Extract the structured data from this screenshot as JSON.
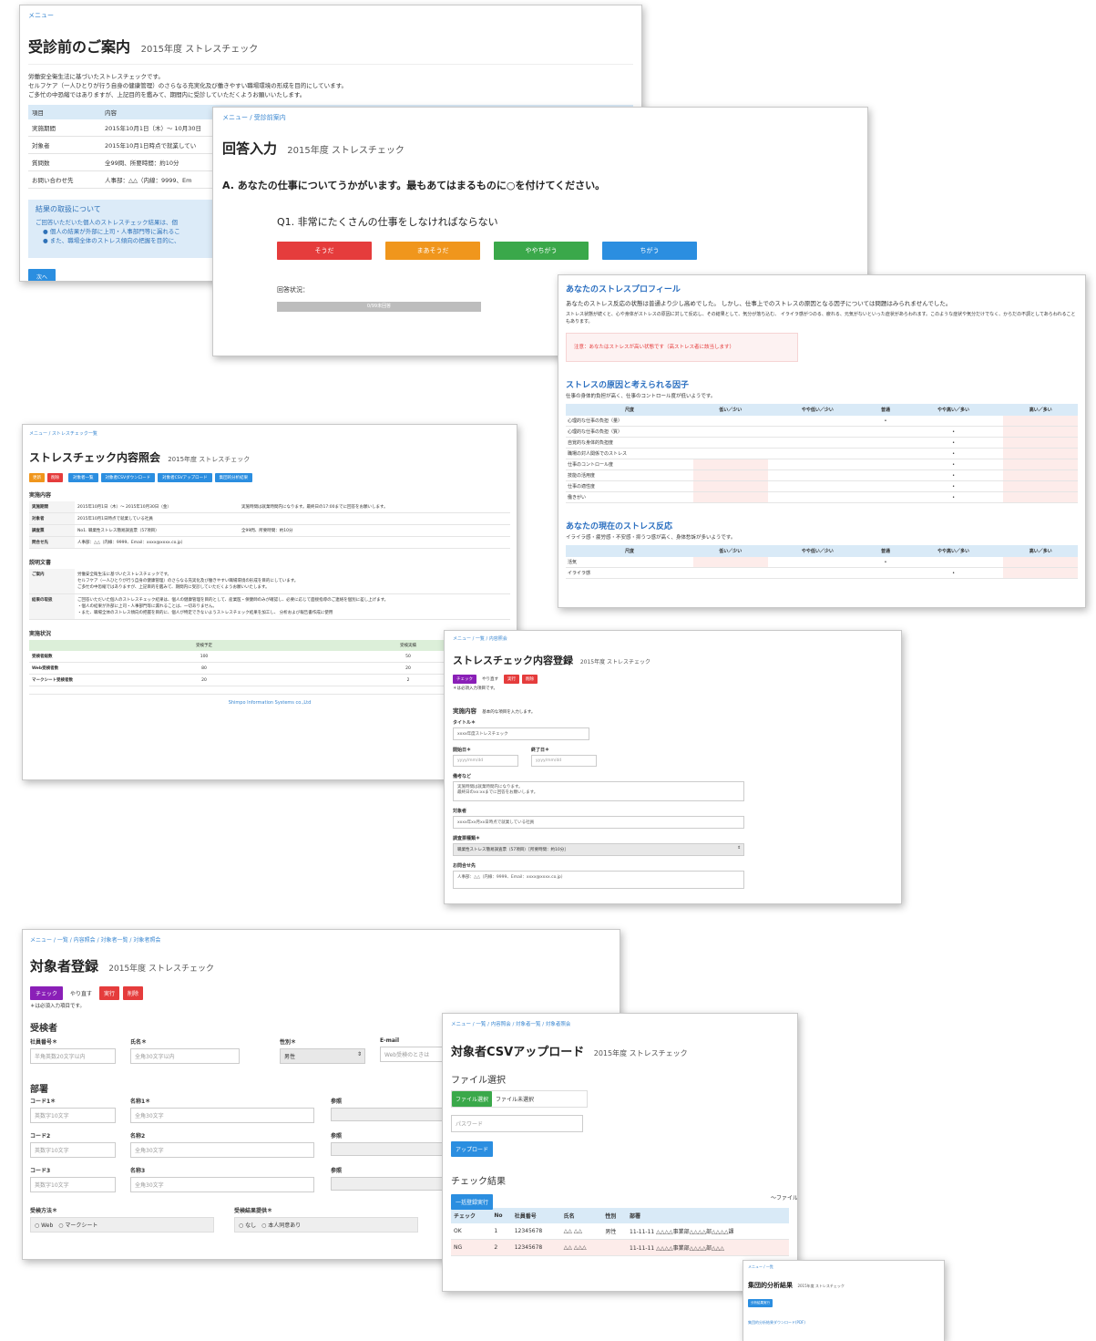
{
  "w1": {
    "crumb": "メニュー",
    "title": "受診前のご案内",
    "subtitle": "2015年度 ストレスチェック",
    "intro": [
      "労働安全衛生法に基づいたストレスチェックです。",
      "セルフケア（一人ひとりが行う自身の健康管理）のさらなる充実化及び働きやすい職場環境の形成を目的にしています。",
      "ご多忙の中恐縮ではありますが、上記目的を鑑みて、期間内に受診していただくようお願いいたします。"
    ],
    "table_head": [
      "項目",
      "内容",
      "備考"
    ],
    "rows": [
      [
        "実施期間",
        "2015年10月1日（木）〜 10月30日"
      ],
      [
        "対象者",
        "2015年10月1日時点で就業してい"
      ],
      [
        "質問数",
        "全99問、所要時間：約10分"
      ],
      [
        "お問い合わせ先",
        "人事部：△△（内線：9999、Em"
      ]
    ],
    "notice_title": "結果の取扱について",
    "notice_lines": [
      "ご回答いただいた個人のストレスチェック結果は、個",
      "● 個人の結果が外部に上司・人事部門等に漏れるこ",
      "● また、職場全体のストレス傾向の把握を目的に、"
    ],
    "next": "次へ"
  },
  "w2": {
    "crumb": "メニュー / 受診前案内",
    "title": "回答入力",
    "subtitle": "2015年度 ストレスチェック",
    "section": "A. あなたの仕事についてうかがいます。最もあてはまるものに○を付けてください。",
    "question": "Q1. 非常にたくさんの仕事をしなければならない",
    "answers": [
      "そうだ",
      "まあそうだ",
      "ややちがう",
      "ちがう"
    ],
    "status_label": "回答状況：",
    "progress_text": "0/99未回答",
    "progress": 0
  },
  "w3": {
    "title1": "あなたのストレスプロフィール",
    "desc1": "あなたのストレス反応の状態は普通より少し高めでした。 しかし、仕事上でのストレスの原因となる因子については問題はみられませんでした。",
    "desc2": "ストレス状態が続くと、心や身体がストレスの原因に対して反応し、その結果として、気分が落ち込む、 イライラ感がつのる、疲れる、元気がないといった症状があらわれます。このような症状や気分だけでなく、からだの不調としてあらわれることもあります。",
    "warning": "注意：あなたはストレスが高い状態です（高ストレス者に該当します）",
    "title2": "ストレスの原因と考えられる因子",
    "desc3": "仕事の身体的負担が高く、仕事のコントロール度が低いようです。",
    "cols": [
      "尺度",
      "低い／少い",
      "やや低い／少い",
      "普通",
      "やや高い／多い",
      "高い／多い"
    ],
    "rows": [
      {
        "label": "心理的な仕事の負担（量）",
        "mark": 3
      },
      {
        "label": "心理的な仕事の負担（質）",
        "mark": 4
      },
      {
        "label": "自覚的な身体的負担度",
        "mark": 4
      },
      {
        "label": "職場の対人関係でのストレス",
        "mark": 4
      },
      {
        "label": "仕事のコントロール度",
        "mark": 4
      },
      {
        "label": "技能の活用度",
        "mark": 4
      },
      {
        "label": "仕事の適性度",
        "mark": 4
      },
      {
        "label": "働きがい",
        "mark": 4
      }
    ],
    "title3": "あなたの現在のストレス反応",
    "desc4": "イライラ感・疲労感・不安感・抑うつ感が高く、身体愁訴が多いようです。",
    "rows2": [
      {
        "label": "活気",
        "mark": 3
      },
      {
        "label": "イライラ感",
        "mark": 4
      }
    ],
    "mark": "•"
  },
  "w4": {
    "crumb": "メニュー / ストレスチェック一覧",
    "title": "ストレスチェック内容照会",
    "subtitle": "2015年度 ストレスチェック",
    "buttons": [
      "更新",
      "削除",
      "対象者一覧",
      "対象者CSVダウンロード",
      "対象者CSVアップロード",
      "集団的分析結果"
    ],
    "sec1": "実施内容",
    "rows": [
      [
        "実施期間",
        "2015年10月1日（木）〜 2015年10月30日（金）",
        "実施時間は就業時間内になります。最終日の17:00までに回答をお願いします。"
      ],
      [
        "対象者",
        "2015年10月1日時点で就業している社員",
        ""
      ],
      [
        "調査票",
        "No1. 職業性ストレス簡易調査票（57項目）",
        "全99問、所要時間：約10分"
      ],
      [
        "問合せ先",
        "人事部：△△（内線：9999、Email：xxxx@xxxx.co.jp）",
        ""
      ]
    ],
    "sec2": "説明文書",
    "doc_label1": "ご案内",
    "doc1": [
      "労働安全衛生法に基づいたストレスチェックです。",
      "セルフケア（一人ひとりが行う自身の健康管理）のさらなる充実化及び働きやすい職場環境の形成を目的にしています。",
      "ご多忙の中恐縮ではありますが、上記目的を鑑みて、期間内に受診していただくようお願いいたします。"
    ],
    "doc_label2": "結果の取扱",
    "doc2": [
      "ご回答いただいた個人のストレスチェック結果は、個人の健康管理を目的として、産業医・保健師のみが確認し、必要に応じて面接指導のご連絡を個別に差し上げます。",
      "・個人の結果が外部に上司・人事部門等に漏れることは、一切ありません。",
      "・また、職場全体のストレス傾向の把握を目的に、個人が特定できないようストレスチェック結果を加工し、 分析および報告書作成に使用"
    ],
    "sec3": "実施状況",
    "stat_cols": [
      "",
      "受検予定",
      "受検実績"
    ],
    "stats": [
      [
        "受検者総数",
        "100",
        "50"
      ],
      [
        "Web受検者数",
        "80",
        "20"
      ],
      [
        "マークシート受検者数",
        "20",
        "2"
      ]
    ],
    "footer": "Shimpo Information Systems co.,Ltd"
  },
  "w5": {
    "crumb": "メニュー / 一覧 / 内容照会",
    "title": "ストレスチェック内容登録",
    "subtitle": "2015年度 ストレスチェック",
    "btn_check": "チェック",
    "btn_redo": "やり直す",
    "btn_run": "実行",
    "btn_delete": "削除",
    "required": "＊は必須入力項目です。",
    "sec": "実施内容",
    "sec_note": "基本的な項目を入力します。",
    "f_title": "タイトル＊",
    "v_title": "xxxx年度ストレスチェック",
    "f_start": "開始日＊",
    "f_end": "終了日＊",
    "date_ph": "yyyy/mm/dd",
    "f_note": "備考など",
    "v_note1": "実施時間は就業時間内になります。",
    "v_note2": "最終日のxx:xxまでに回答をお願いします。",
    "f_target": "対象者",
    "v_target": "xxxx年xx月xx日時点で就業している社員",
    "f_form": "調査票種類＊",
    "v_form": "職業性ストレス簡易調査票（57項目）［所要時間：約10分］",
    "f_contact": "お問合せ先",
    "v_contact": "人事部：△△（内線：9999、Email：xxxx@xxxx.co.jp）"
  },
  "w6": {
    "crumb": "メニュー / 一覧 / 内容照会 / 対象者一覧 / 対象者照会",
    "title": "対象者登録",
    "subtitle": "2015年度 ストレスチェック",
    "btn_check": "チェック",
    "btn_redo": "やり直す",
    "btn_run": "実行",
    "btn_delete": "削除",
    "required": "＊は必須入力項目です。",
    "sec1": "受検者",
    "f_emp": "社員番号＊",
    "p_emp": "半角英数20文字以内",
    "f_name": "氏名＊",
    "p_name": "全角30文字以内",
    "f_gender": "性別＊",
    "v_gender": "男性",
    "f_email": "E-mail",
    "p_email": "Web受検のときは",
    "sec2": "部署",
    "dept": [
      {
        "code": "コード1＊",
        "name": "名称1＊"
      },
      {
        "code": "コード2",
        "name": "名称2"
      },
      {
        "code": "コード3",
        "name": "名称3"
      }
    ],
    "p_code": "英数字10文字",
    "p_dname": "全角30文字",
    "f_ref": "参照",
    "f_method": "受検方法＊",
    "opt_web": "Web",
    "opt_mark": "マークシート",
    "f_provide": "受検結果提供＊",
    "opt_none": "なし",
    "opt_agree": "本人同意あり"
  },
  "w7": {
    "crumb": "メニュー / 一覧 / 内容照会 / 対象者一覧 / 対象者照会",
    "title": "対象者CSVアップロード",
    "subtitle": "2015年度 ストレスチェック",
    "sec1": "ファイル選択",
    "file_btn": "ファイル選択",
    "file_none": "ファイル未選択",
    "pw_ph": "パスワード",
    "upload": "アップロード",
    "sec2": "チェック結果",
    "bulk": "一括登録実行",
    "right_note": "〜ファイル",
    "cols": [
      "チェック",
      "No",
      "社員番号",
      "氏名",
      "性別",
      "部署"
    ],
    "rows": [
      [
        "OK",
        "1",
        "12345678",
        "△△ △△",
        "男性",
        "11-11-11 △△△△事業部△△△△部△△△△課"
      ],
      [
        "NG",
        "2",
        "12345678",
        "△△ △△△",
        "",
        "11-11-11 △△△△事業部△△△△部△△△"
      ]
    ]
  },
  "w8": {
    "crumb": "メニュー / 一覧",
    "title": "集団的分析結果",
    "subtitle": "2015年度 ストレスチェック",
    "btn": "分析結果実行",
    "link": "集団的分析結果ダウンロード(PDF)"
  },
  "colors": {
    "blue": "#2b8ee0",
    "orange": "#f0961c",
    "red": "#e53c3c",
    "purple": "#8a1fb7",
    "green": "#3aa84a",
    "link": "#3a87d1",
    "high_cell": "#fdecea"
  }
}
